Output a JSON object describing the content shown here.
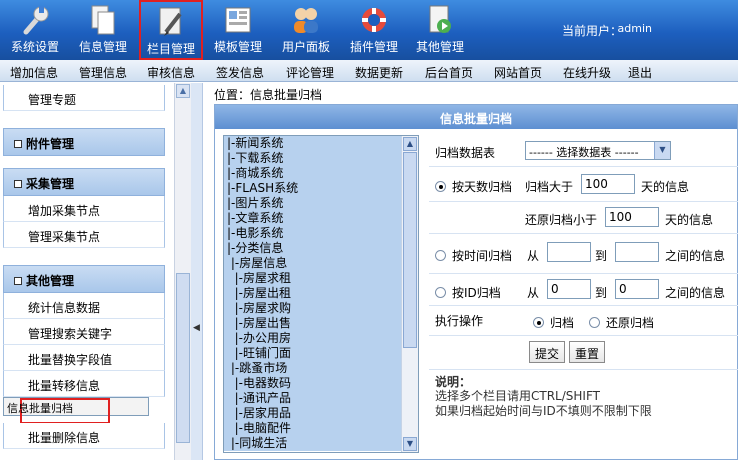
{
  "toolbar": {
    "items": [
      {
        "label": "系统设置",
        "icon": "wrench-icon"
      },
      {
        "label": "信息管理",
        "icon": "documents-icon"
      },
      {
        "label": "栏目管理",
        "icon": "column-pencil-icon"
      },
      {
        "label": "模板管理",
        "icon": "template-icon"
      },
      {
        "label": "用户面板",
        "icon": "users-icon"
      },
      {
        "label": "插件管理",
        "icon": "lifebuoy-icon"
      },
      {
        "label": "其他管理",
        "icon": "play-document-icon"
      }
    ],
    "current_user_label": "当前用户：",
    "current_user": "admin"
  },
  "menu": [
    "增加信息",
    "管理信息",
    "审核信息",
    "签发信息",
    "评论管理",
    "数据更新",
    "后台首页",
    "网站首页",
    "在线升级",
    "退出"
  ],
  "left": {
    "top_item": "管理专题",
    "sections": [
      {
        "title": "附件管理",
        "items": []
      },
      {
        "title": "采集管理",
        "items": [
          "增加采集节点",
          "管理采集节点"
        ]
      },
      {
        "title": "其他管理",
        "items": [
          "统计信息数据",
          "管理搜索关键字",
          "批量替换字段值",
          "批量转移信息",
          "信息批量归档",
          "批量删除信息"
        ]
      }
    ]
  },
  "breadcrumb": "位置：信息批量归档",
  "panel_title": "信息批量归档",
  "category_list": [
    "|-新闻系统",
    "|-下载系统",
    "|-商城系统",
    "|-FLASH系统",
    "|-图片系统",
    "|-文章系统",
    "|-电影系统",
    "|-分类信息",
    " |-房屋信息",
    "  |-房屋求租",
    "  |-房屋出租",
    "  |-房屋求购",
    "  |-房屋出售",
    "  |-办公用房",
    "  |-旺铺门面",
    " |-跳蚤市场",
    "  |-电器数码",
    "  |-通讯产品",
    "  |-居家用品",
    "  |-电脑配件",
    " |-同城生活"
  ],
  "form": {
    "table_label": "归档数据表",
    "table_select": "------ 选择数据表 ------",
    "by_days_label": "按天数归档",
    "archive_gt": "归档大于",
    "days1": "100",
    "days_suffix1": "天的信息",
    "restore_lt": "还原归档小于",
    "days2": "100",
    "days_suffix2": "天的信息",
    "by_time_label": "按时间归档",
    "from": "从",
    "to": "到",
    "between": "之间的信息",
    "by_id_label": "按ID归档",
    "id_from": "0",
    "id_to": "0",
    "exec_label": "执行操作",
    "op_archive": "归档",
    "op_restore": "还原归档",
    "submit": "提交",
    "reset": "重置",
    "note_title": "说明：",
    "note1": "选择多个栏目请用CTRL/SHIFT",
    "note2": "如果归档起始时间与ID不填则不限制下限"
  }
}
